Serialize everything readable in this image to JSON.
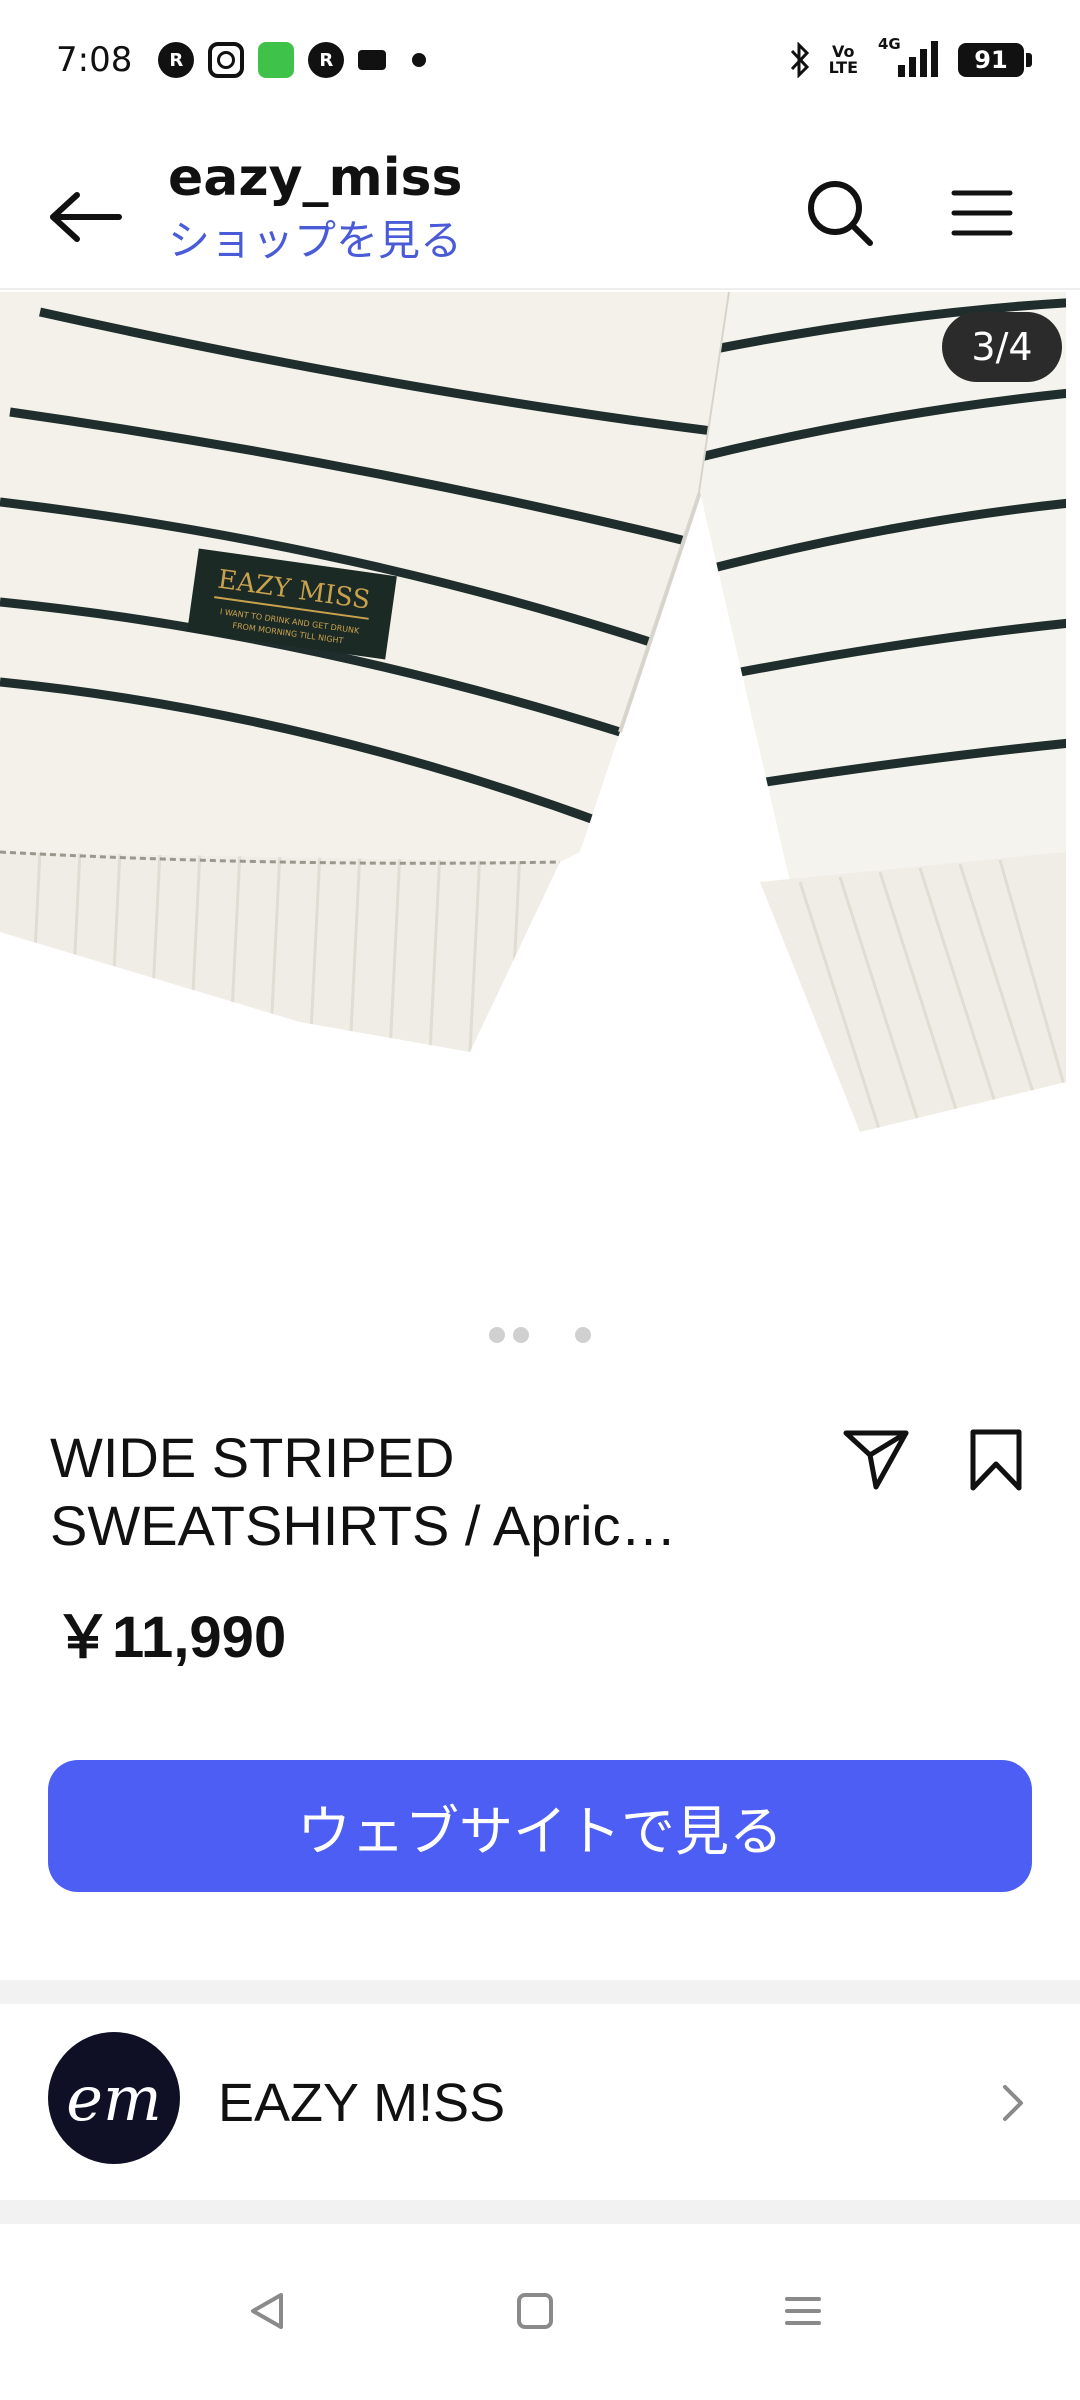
{
  "status_bar": {
    "time": "7:08",
    "app_icons": [
      "rakuten-link-icon",
      "instagram-icon",
      "green-app-icon",
      "rakuten-link-icon",
      "notification-icon",
      "dot-icon"
    ],
    "network_label_top": "Vo",
    "network_label_bottom": "LTE",
    "network_type": "4G",
    "battery": "91"
  },
  "header": {
    "account_name": "eazy_miss",
    "shop_link": "ショップを見る"
  },
  "product": {
    "image_counter": "3/4",
    "image_index": 3,
    "image_total": 4,
    "title": "WIDE STRIPED SWEATSHIRTS / Apric…",
    "price": "￥11,990",
    "cta_label": "ウェブサイトで見る",
    "label_brand": "EAZY MISS",
    "label_line1": "I WANT TO DRINK AND GET DRUNK",
    "label_line2": "FROM MORNING TILL NIGHT"
  },
  "shop": {
    "avatar_text": "em",
    "name": "EAZY M!SS"
  },
  "colors": {
    "accent": "#4d5ef4",
    "link": "#4a5bd8",
    "stripe": "#1f2e2c",
    "fabric": "#f3f1ea"
  }
}
